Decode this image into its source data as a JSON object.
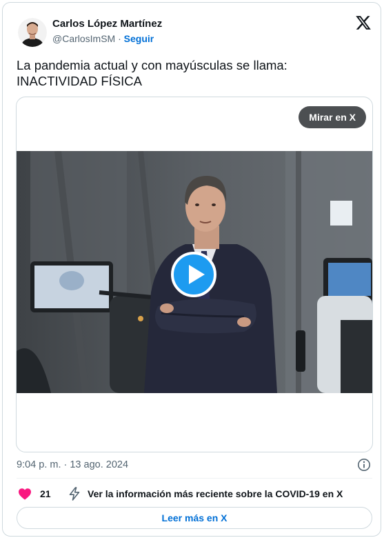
{
  "author": {
    "name": "Carlos López Martínez",
    "handle": "@CarlosImSM",
    "separator": "·",
    "follow_label": "Seguir"
  },
  "tweet": {
    "text_line1": "La pandemia actual y con mayúsculas se llama:",
    "text_line2": "INACTIVIDAD FÍSICA"
  },
  "media": {
    "watch_label": "Mirar en X"
  },
  "footer": {
    "timestamp": "9:04 p. m. · 13 ago. 2024",
    "like_count": "21",
    "covid_label": "Ver la información más reciente sobre la COVID-19 en X",
    "read_more_label": "Leer más en X"
  },
  "icons": [
    "x-logo-icon",
    "play-icon",
    "info-icon",
    "heart-icon",
    "bolt-icon"
  ],
  "colors": {
    "link": "#006fd6",
    "like": "#f91880",
    "secondary_text": "#536471",
    "primary_text": "#0f1419",
    "border": "#cfd9de",
    "play_button": "#1d9bf0"
  }
}
